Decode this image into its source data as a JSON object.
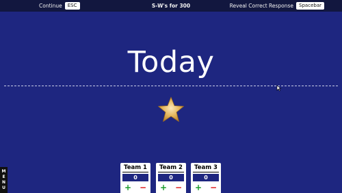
{
  "topbar": {
    "continue_label": "Continue",
    "continue_key": "ESC",
    "title": "S-W's for 300",
    "reveal_label": "Reveal Correct Response",
    "reveal_key": "Spacebar"
  },
  "clue": {
    "text": "Today"
  },
  "menu": {
    "letters": [
      "M",
      "E",
      "N",
      "U"
    ]
  },
  "teams": [
    {
      "name": "Team 1",
      "score": "0",
      "plus": "+",
      "minus": "−"
    },
    {
      "name": "Team 2",
      "score": "0",
      "plus": "+",
      "minus": "−"
    },
    {
      "name": "Team 3",
      "score": "0",
      "plus": "+",
      "minus": "−"
    }
  ],
  "colors": {
    "background": "#1e2680",
    "topbar": "#12173f",
    "plus": "#1a9a2a",
    "minus": "#dd1111",
    "star": "#e4b45a"
  },
  "icons": {
    "star": "star-icon",
    "cursor": "mouse-cursor-icon"
  }
}
